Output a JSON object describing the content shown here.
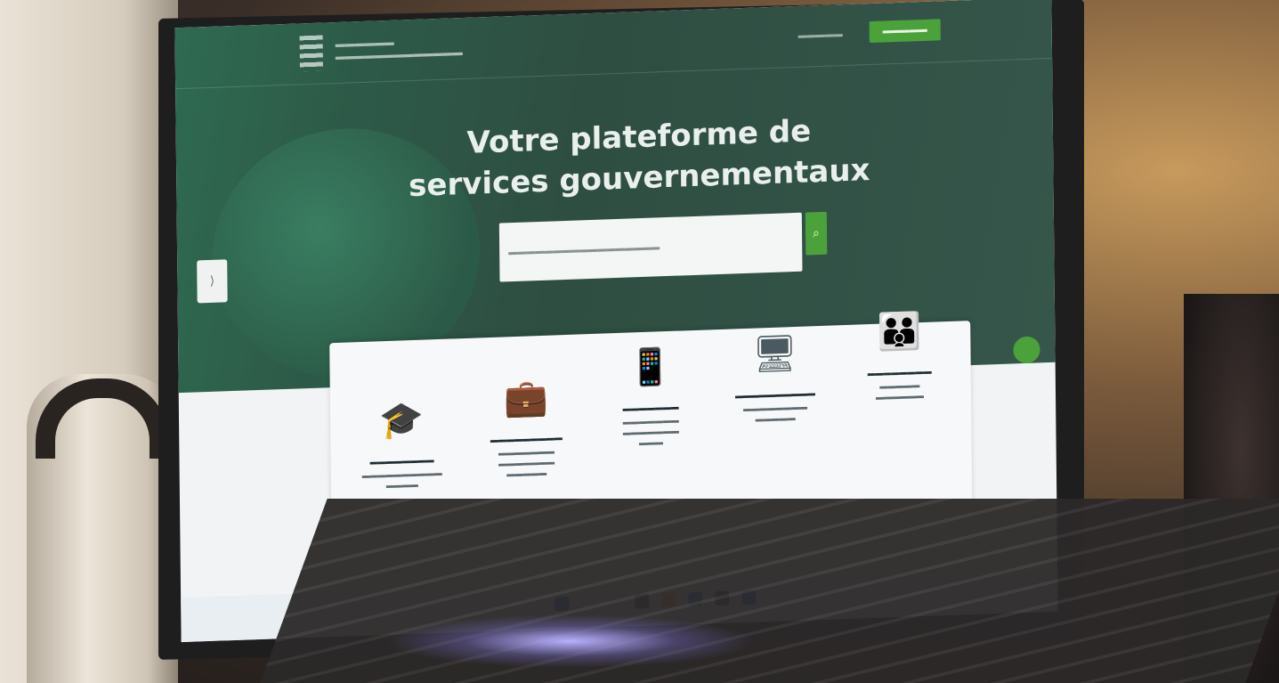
{
  "page": {
    "hero_title": "Votre plateforme de services gouvernementaux"
  },
  "colors": {
    "hero_green": "#2e5a48",
    "accent_green": "#4ca23a",
    "card_bg": "#f7f8f9"
  },
  "icons": [
    "graduation-cap-icon",
    "briefcase-icon",
    "phone-qr-icon",
    "monitor-icon",
    "family-icon"
  ]
}
